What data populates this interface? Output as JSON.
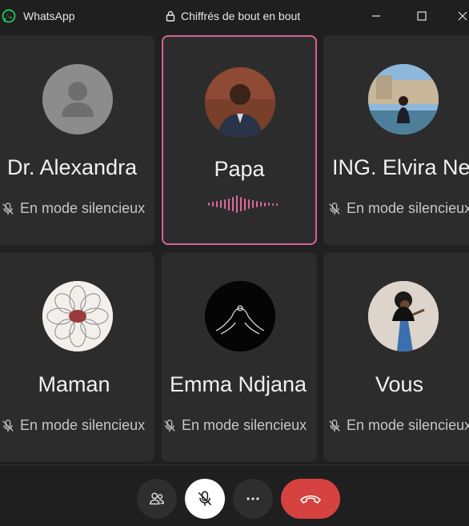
{
  "titlebar": {
    "app_name": "WhatsApp",
    "encryption_text": "Chiffrés de bout en bout"
  },
  "participants": [
    {
      "name": "Dr. Alexandra",
      "status": "En mode silencieux",
      "muted": true
    },
    {
      "name": "Papa",
      "status": "",
      "speaking": true
    },
    {
      "name": "ING. Elvira Ne",
      "status": "En mode silencieux",
      "muted": true
    },
    {
      "name": "Maman",
      "status": "En mode silencieux",
      "muted": true
    },
    {
      "name": "Emma Ndjana",
      "status": "En mode silencieux",
      "muted": true
    },
    {
      "name": "Vous",
      "status": "En mode silencieux",
      "muted": true
    }
  ],
  "controls": {
    "participants_icon": "people-icon",
    "mute_icon": "mic-off-icon",
    "more_icon": "more-icon",
    "end_icon": "end-call-icon"
  },
  "colors": {
    "accent": "#d9609a",
    "end_call": "#d6423f",
    "whatsapp_green": "#25d366"
  }
}
